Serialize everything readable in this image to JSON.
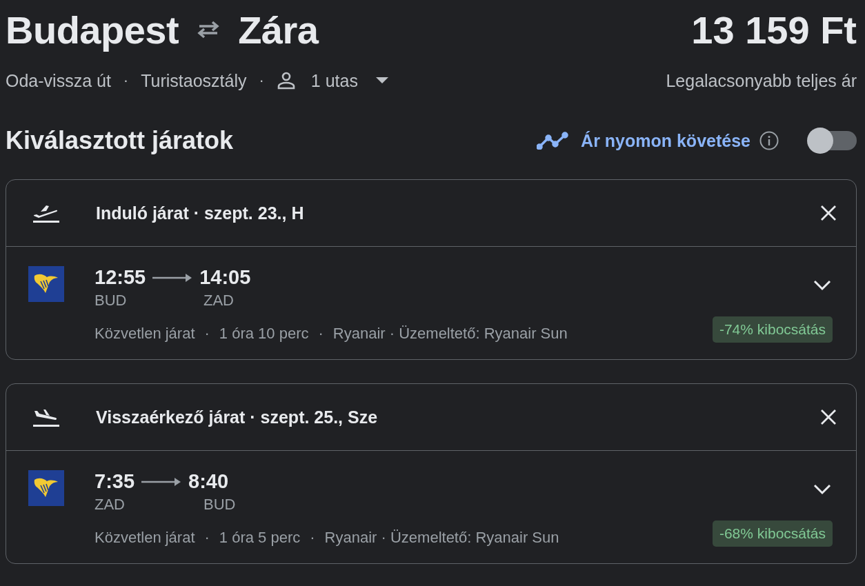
{
  "route": {
    "origin": "Budapest",
    "destination": "Zára"
  },
  "price": {
    "amount": "13 159 Ft",
    "caption": "Legalacsonyabb teljes ár"
  },
  "trip": {
    "separator": "·",
    "type": "Oda-vissza út",
    "cabin": "Turistaosztály",
    "passengers": "1 utas"
  },
  "section": {
    "title": "Kiválasztott járatok",
    "tracking": {
      "label": "Ár nyomon követése",
      "on": false
    }
  },
  "flights": [
    {
      "kind": "departure",
      "header": "Induló járat · szept. 23., H",
      "expanded": false,
      "depart_time": "12:55",
      "arrive_time": "14:05",
      "from": "BUD",
      "to": "ZAD",
      "details": [
        "Közvetlen járat",
        "1 óra 10 perc",
        "Ryanair · Üzemeltető: Ryanair Sun"
      ],
      "emissions": "-74% kibocsátás"
    },
    {
      "kind": "return",
      "header": "Visszaérkező járat · szept. 25., Sze",
      "expanded": false,
      "depart_time": "7:35",
      "arrive_time": "8:40",
      "from": "ZAD",
      "to": "BUD",
      "details": [
        "Közvetlen járat",
        "1 óra 5 perc",
        "Ryanair · Üzemeltető: Ryanair Sun"
      ],
      "emissions": "-68% kibocsátás"
    }
  ]
}
